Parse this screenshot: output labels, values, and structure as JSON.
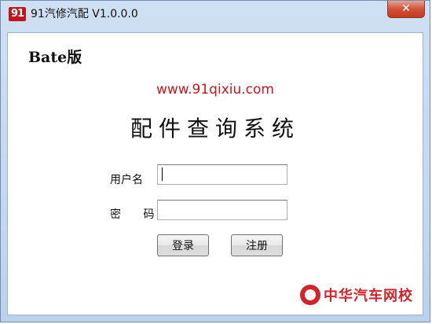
{
  "window": {
    "title": "91汽修汽配 V1.0.0.0",
    "icon_text": "91",
    "close_label": "✕"
  },
  "content": {
    "edition": "Bate版",
    "url": "www.91qixiu.com",
    "system_title": "配件查询系统"
  },
  "form": {
    "username_label": "用户名",
    "password_label": "密 码",
    "username_value": "",
    "password_value": "",
    "login_button": "登录",
    "register_button": "注册"
  },
  "watermark": {
    "text": "中华汽车网校"
  },
  "colors": {
    "accent_red": "#c8161d",
    "titlebar": "#bcd2ec"
  }
}
